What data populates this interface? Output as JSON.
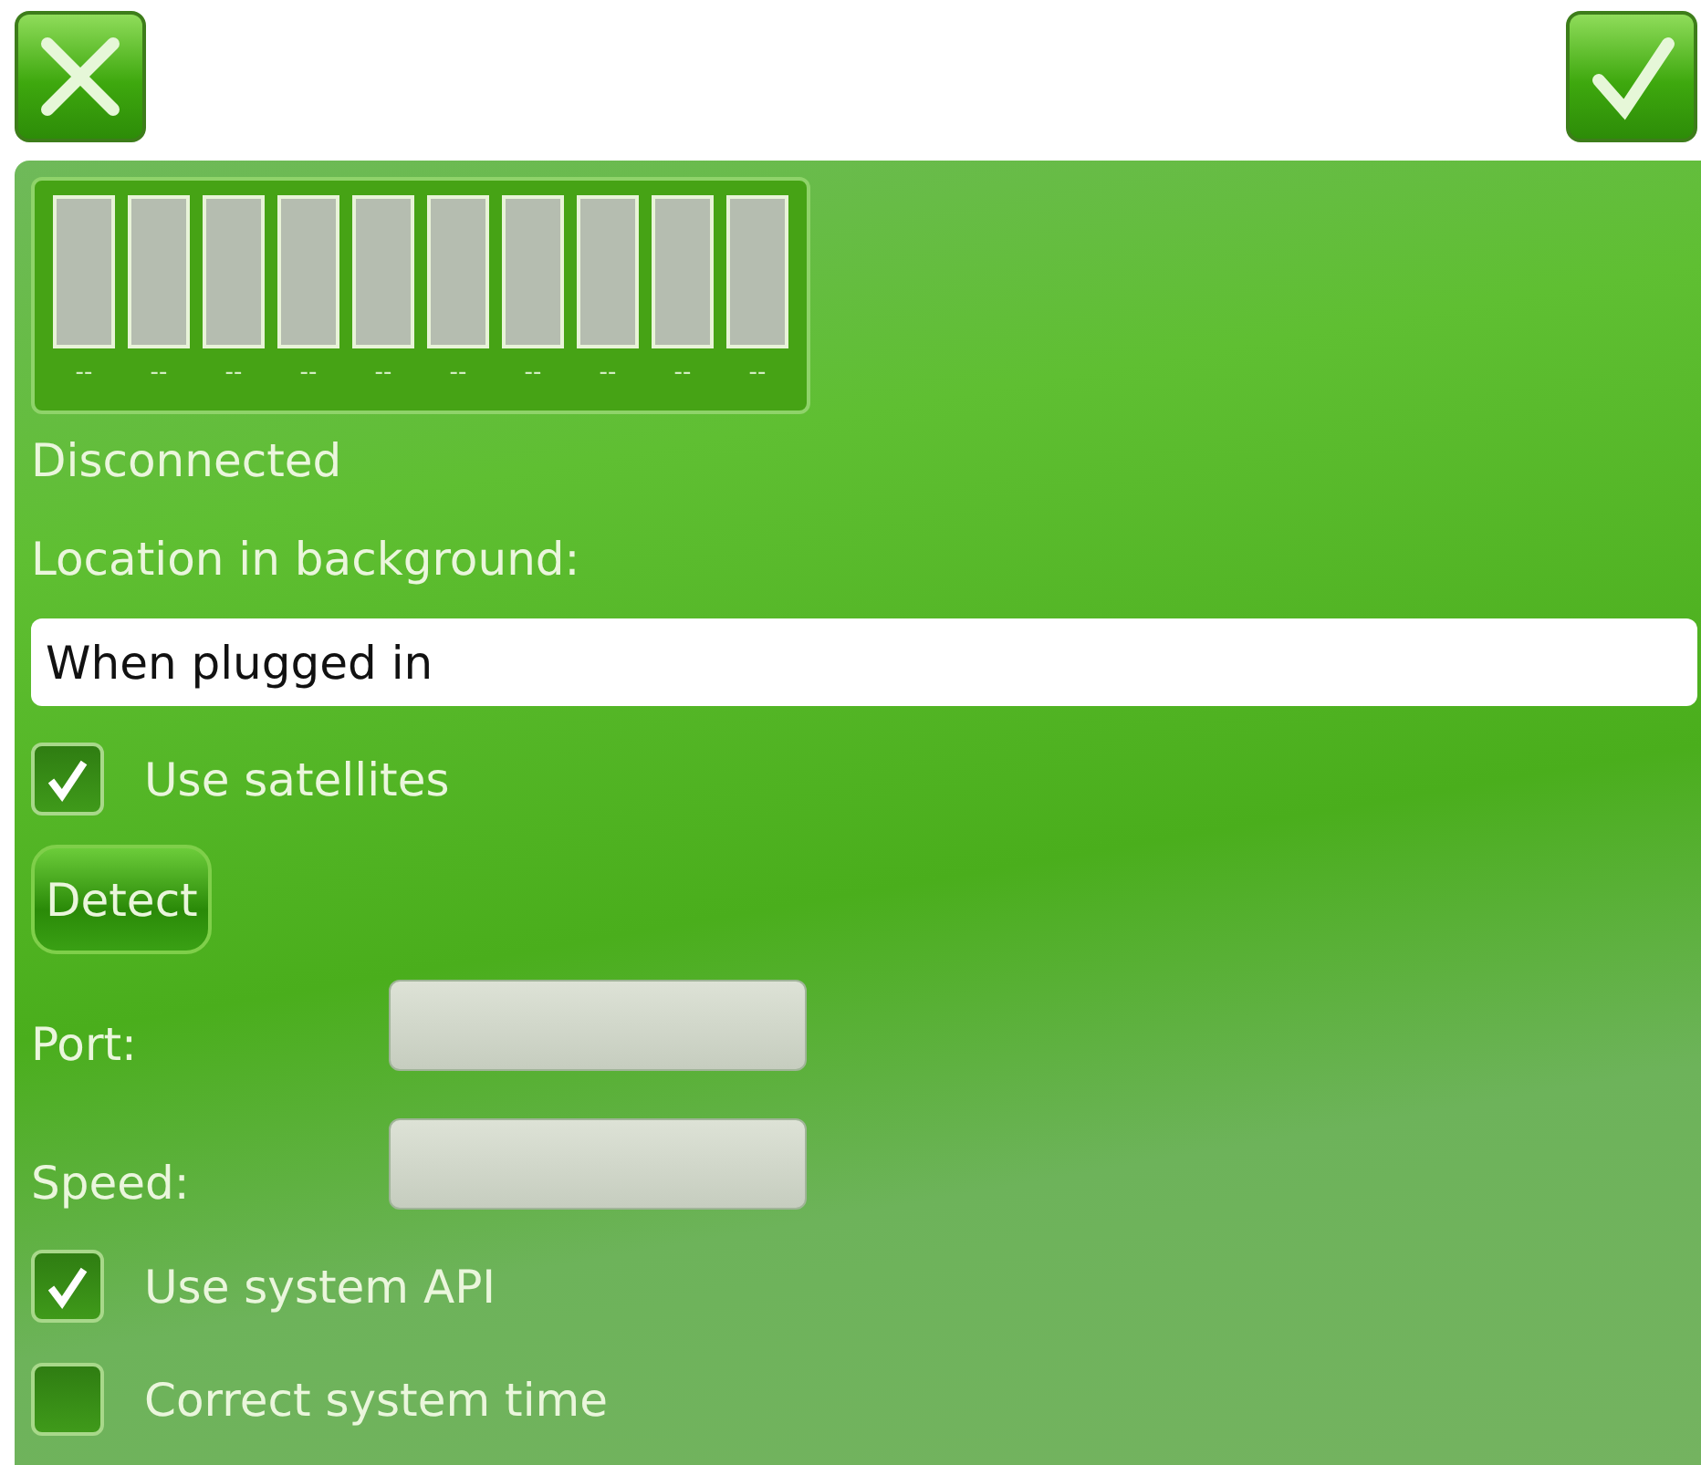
{
  "toolbar": {
    "cancel": {
      "kind": "cancel"
    },
    "confirm": {
      "kind": "confirm"
    }
  },
  "signal_bars": [
    {
      "label": "--"
    },
    {
      "label": "--"
    },
    {
      "label": "--"
    },
    {
      "label": "--"
    },
    {
      "label": "--"
    },
    {
      "label": "--"
    },
    {
      "label": "--"
    },
    {
      "label": "--"
    },
    {
      "label": "--"
    },
    {
      "label": "--"
    }
  ],
  "status": "Disconnected",
  "location_label": "Location in background:",
  "location_value": "When plugged in",
  "use_satellites": {
    "label": "Use satellites",
    "checked": true
  },
  "detect_button": "Detect",
  "fields": [
    {
      "label": "Port:"
    },
    {
      "label": "Speed:"
    }
  ],
  "options": [
    {
      "label": "Use system API",
      "checked": true
    },
    {
      "label": "Correct system time",
      "checked": false
    }
  ]
}
